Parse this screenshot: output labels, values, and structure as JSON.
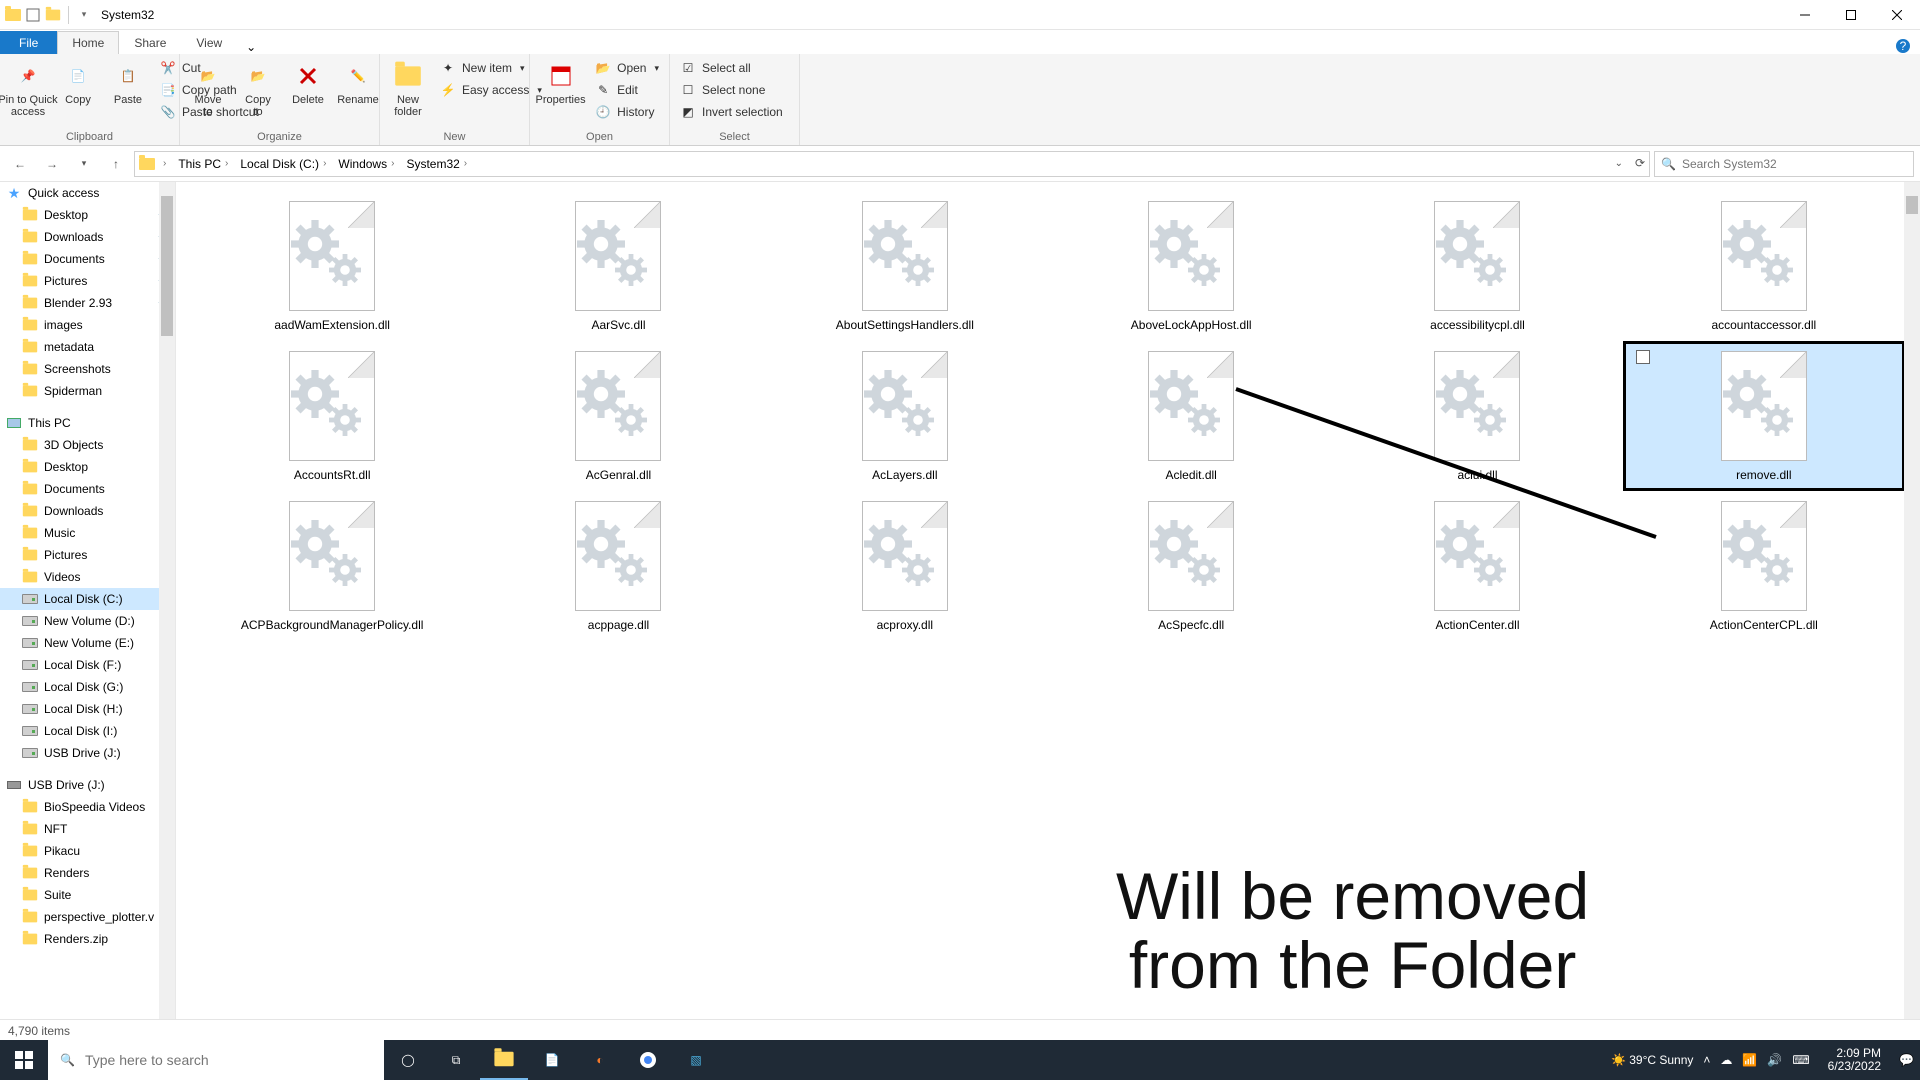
{
  "window": {
    "title": "System32"
  },
  "tabs": {
    "file": "File",
    "home": "Home",
    "share": "Share",
    "view": "View"
  },
  "ribbon": {
    "clipboard": {
      "label": "Clipboard",
      "pin": "Pin to Quick\naccess",
      "copy": "Copy",
      "paste": "Paste",
      "cut": "Cut",
      "copypath": "Copy path",
      "pastesc": "Paste shortcut"
    },
    "organize": {
      "label": "Organize",
      "moveto": "Move\nto",
      "copyto": "Copy\nto",
      "delete": "Delete",
      "rename": "Rename"
    },
    "new": {
      "label": "New",
      "newfolder": "New\nfolder",
      "newitem": "New item",
      "easy": "Easy access"
    },
    "open": {
      "label": "Open",
      "properties": "Properties",
      "open": "Open",
      "edit": "Edit",
      "history": "History"
    },
    "select": {
      "label": "Select",
      "all": "Select all",
      "none": "Select none",
      "invert": "Invert selection"
    }
  },
  "breadcrumb": [
    "This PC",
    "Local Disk (C:)",
    "Windows",
    "System32"
  ],
  "search": {
    "placeholder": "Search System32"
  },
  "nav": {
    "quick": {
      "label": "Quick access",
      "pinned": [
        "Desktop",
        "Downloads",
        "Documents",
        "Pictures",
        "Blender 2.93"
      ],
      "recent": [
        "images",
        "metadata",
        "Screenshots",
        "Spiderman"
      ]
    },
    "thispc": {
      "label": "This PC",
      "items": [
        "3D Objects",
        "Desktop",
        "Documents",
        "Downloads",
        "Music",
        "Pictures",
        "Videos",
        "Local Disk (C:)",
        "New Volume (D:)",
        "New Volume (E:)",
        "Local Disk (F:)",
        "Local Disk (G:)",
        "Local Disk (H:)",
        "Local Disk (I:)",
        "USB Drive (J:)"
      ]
    },
    "usb": {
      "label": "USB Drive (J:)",
      "items": [
        "BioSpeedia Videos",
        "NFT",
        "Pikacu",
        "Renders",
        "Suite",
        "perspective_plotter.v",
        "Renders.zip"
      ]
    }
  },
  "files": [
    "aadWamExtension.dll",
    "AarSvc.dll",
    "AboutSettingsHandlers.dll",
    "AboveLockAppHost.dll",
    "accessibilitycpl.dll",
    "accountaccessor.dll",
    "AccountsRt.dll",
    "AcGenral.dll",
    "AcLayers.dll",
    "Acledit.dll",
    "aclui.dll",
    "remove.dll",
    "ACPBackgroundManagerPolicy.dll",
    "acppage.dll",
    "acproxy.dll",
    "AcSpecfc.dll",
    "ActionCenter.dll",
    "ActionCenterCPL.dll"
  ],
  "selected_index": 11,
  "status": {
    "items": "4,790 items"
  },
  "annotation": {
    "text": "Will be removed\nfrom the Folder"
  },
  "taskbar": {
    "search_placeholder": "Type here to search",
    "weather": "39°C  Sunny",
    "time": "2:09 PM",
    "date": "6/23/2022"
  }
}
